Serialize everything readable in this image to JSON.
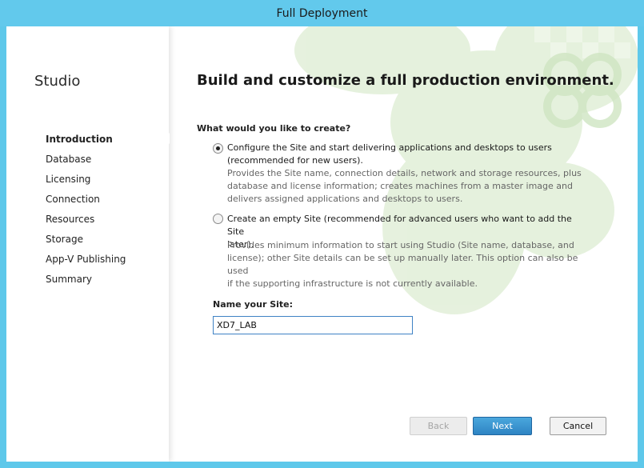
{
  "window": {
    "title": "Full Deployment"
  },
  "sidebar": {
    "title": "Studio",
    "steps": [
      {
        "label": "Introduction",
        "active": true
      },
      {
        "label": "Database"
      },
      {
        "label": "Licensing"
      },
      {
        "label": "Connection"
      },
      {
        "label": "Resources"
      },
      {
        "label": "Storage"
      },
      {
        "label": "App-V Publishing"
      },
      {
        "label": "Summary"
      }
    ]
  },
  "main": {
    "heading": "Build and customize a full production environment.",
    "question": "What would you like to create?",
    "options": [
      {
        "selected": true,
        "label_line1": "Configure the Site and start delivering applications and desktops to users",
        "label_line2": "(recommended for new users).",
        "desc_line1": "Provides the Site name, connection details, network and storage resources, plus",
        "desc_line2": "database and license information; creates machines from a master image and",
        "desc_line3": "delivers assigned applications and desktops to users."
      },
      {
        "selected": false,
        "label_line1": "Create an empty Site (recommended for advanced users who want to add the Site",
        "label_line2": "later).",
        "desc_line1": "Provides minimum information to start using Studio (Site name, database, and",
        "desc_line2": "license); other Site details can be set up manually later. This option can also be used",
        "desc_line3": "if the supporting infrastructure is not currently available."
      }
    ],
    "site_name_label": "Name your Site:",
    "site_name_value": "XD7_LAB"
  },
  "footer": {
    "back_label": "Back",
    "next_label": "Next",
    "cancel_label": "Cancel"
  },
  "colors": {
    "titlebar": "#62c9ec",
    "accent": "#2e84c3",
    "background_art": "#d9ecd0"
  }
}
